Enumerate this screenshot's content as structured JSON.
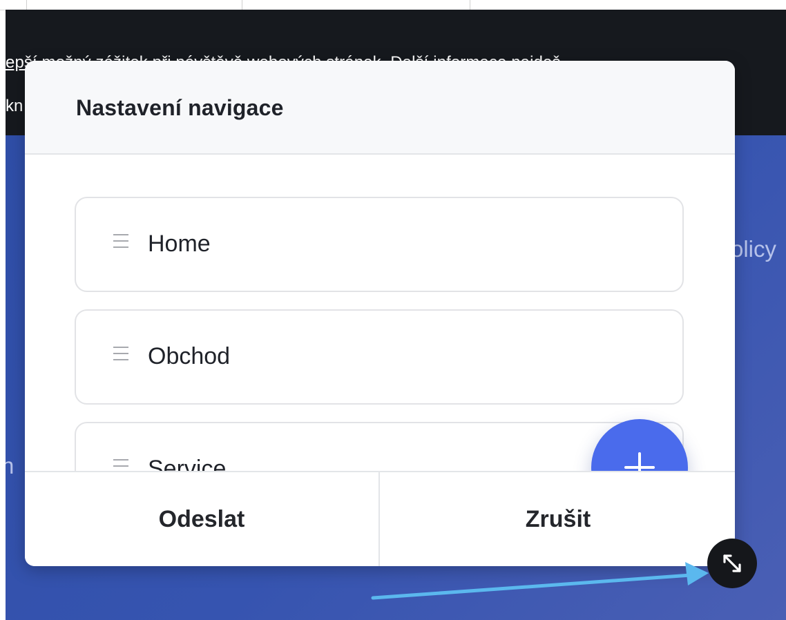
{
  "background": {
    "cookie_line_1": "epší možný zážitek při návštěvě webových stránek. Další informace najdeš",
    "cookie_line_2": "kn",
    "hero_right_text": "olicy",
    "hero_left_text": "n"
  },
  "modal": {
    "title": "Nastavení navigace",
    "items": [
      {
        "label": "Home"
      },
      {
        "label": "Obchod"
      },
      {
        "label": "Service"
      }
    ],
    "add_button_icon": "plus-icon",
    "footer": {
      "submit_label": "Odeslat",
      "cancel_label": "Zrušit"
    }
  },
  "resize_handle": {
    "icon": "resize-diagonal-icon"
  },
  "annotation": {
    "arrow_color": "#5bb8ee"
  },
  "colors": {
    "accent": "#4a6bec",
    "hero_blue": "#3654b0",
    "cookie_bar": "#16191e"
  }
}
